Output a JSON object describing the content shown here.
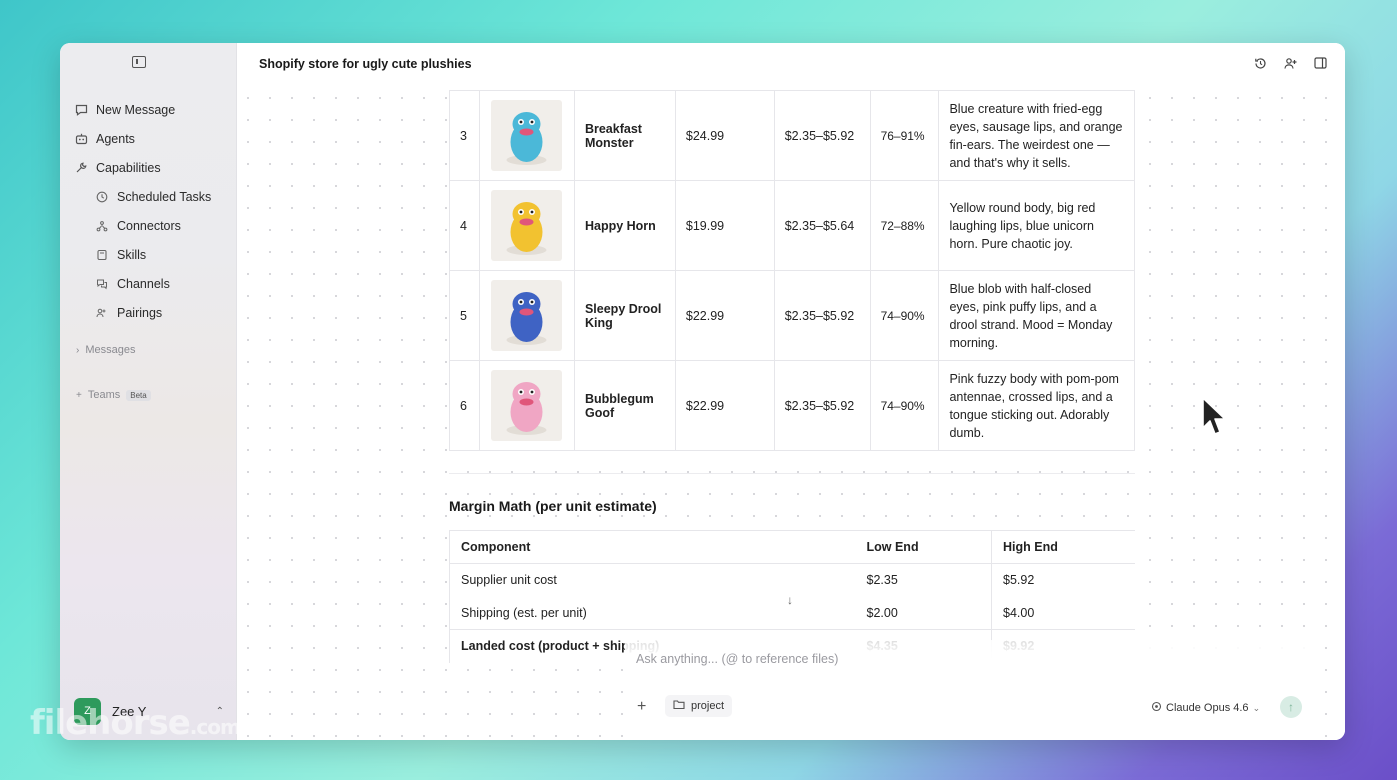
{
  "window": {
    "title": "Shopify store for ugly cute plushies"
  },
  "sidebar": {
    "items": [
      {
        "label": "New Message",
        "icon": "chat-bubble-icon"
      },
      {
        "label": "Agents",
        "icon": "robot-icon"
      },
      {
        "label": "Capabilities",
        "icon": "wrench-icon"
      }
    ],
    "sub_items": [
      {
        "label": "Scheduled Tasks",
        "icon": "clock-icon"
      },
      {
        "label": "Connectors",
        "icon": "connector-icon"
      },
      {
        "label": "Skills",
        "icon": "skills-icon"
      },
      {
        "label": "Channels",
        "icon": "channels-icon"
      },
      {
        "label": "Pairings",
        "icon": "pairings-icon"
      }
    ],
    "messages_label": "Messages",
    "teams_label": "Teams",
    "beta_label": "Beta",
    "user": {
      "initial": "Z",
      "name": "Zee Y",
      "avatar_color": "#2e9a5c"
    }
  },
  "products": [
    {
      "num": "3",
      "name": "Breakfast Monster",
      "price": "$24.99",
      "cost": "$2.35–$5.92",
      "margin": "76–91%",
      "desc": "Blue creature with fried-egg eyes, sausage lips, and orange fin-ears. The weirdest one — and that's why it sells.",
      "color": "#4bb8d8"
    },
    {
      "num": "4",
      "name": "Happy Horn",
      "price": "$19.99",
      "cost": "$2.35–$5.64",
      "margin": "72–88%",
      "desc": "Yellow round body, big red laughing lips, blue unicorn horn. Pure chaotic joy.",
      "color": "#f2c230"
    },
    {
      "num": "5",
      "name": "Sleepy Drool King",
      "price": "$22.99",
      "cost": "$2.35–$5.92",
      "margin": "74–90%",
      "desc": "Blue blob with half-closed eyes, pink puffy lips, and a drool strand. Mood = Monday morning.",
      "color": "#3f63c4"
    },
    {
      "num": "6",
      "name": "Bubblegum Goof",
      "price": "$22.99",
      "cost": "$2.35–$5.92",
      "margin": "74–90%",
      "desc": "Pink fuzzy body with pom-pom antennae, crossed lips, and a tongue sticking out. Adorably dumb.",
      "color": "#f0a6c4"
    }
  ],
  "margin_section": {
    "title": "Margin Math (per unit estimate)",
    "headers": [
      "Component",
      "Low End",
      "High End"
    ],
    "rows": [
      {
        "component": "Supplier unit cost",
        "low": "$2.35",
        "high": "$5.92",
        "bold": false
      },
      {
        "component": "Shipping (est. per unit)",
        "low": "$2.00",
        "high": "$4.00",
        "bold": false
      },
      {
        "component": "Landed cost (product + shipping)",
        "low": "$4.35",
        "high": "$9.92",
        "bold": true
      }
    ]
  },
  "composer": {
    "placeholder": "Ask anything... (@ to reference files)",
    "project_label": "project",
    "model_label": "Claude Opus 4.6"
  },
  "watermark": {
    "main": "filehorse",
    "suffix": ".com"
  },
  "colors": {
    "accent": "#2e9a5c"
  }
}
